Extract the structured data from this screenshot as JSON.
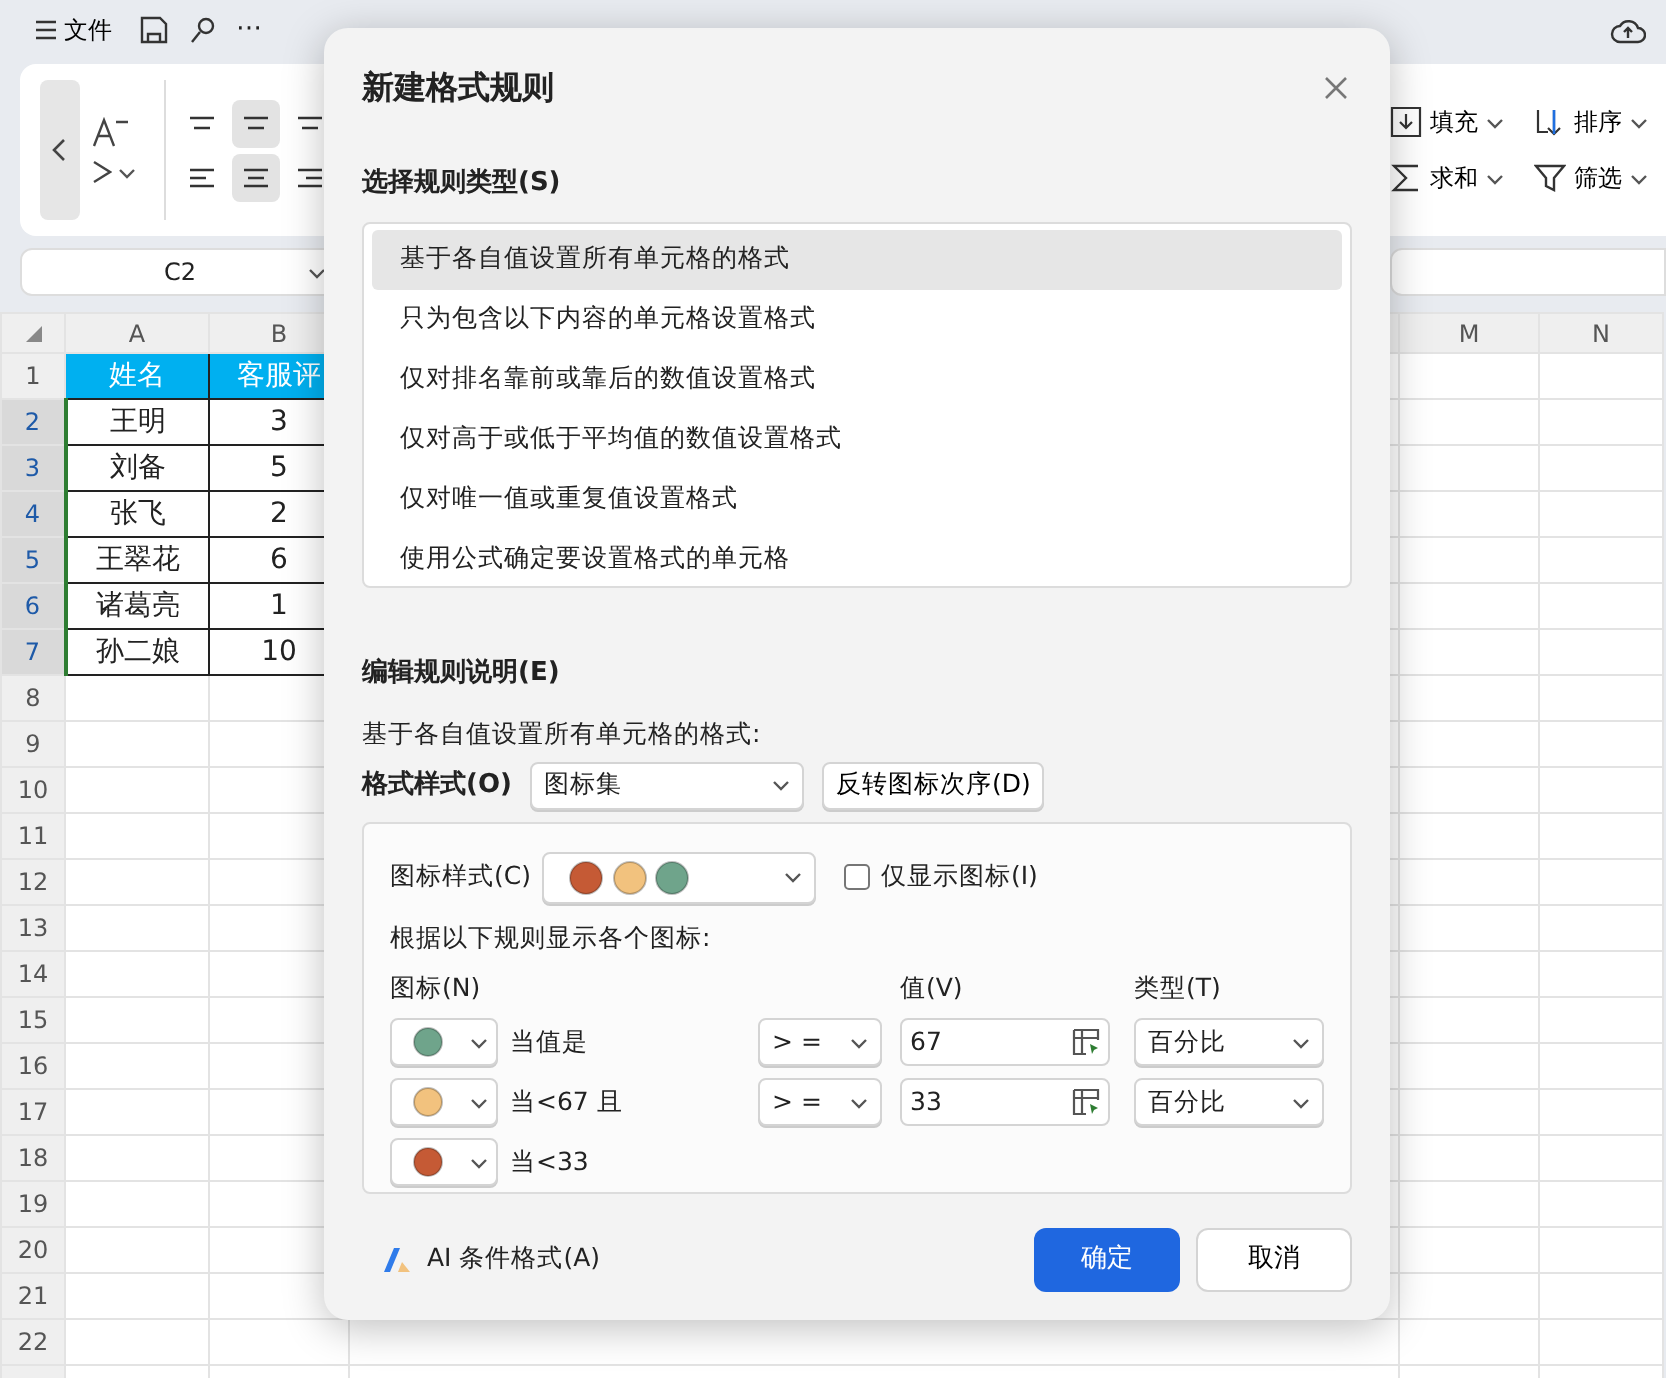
{
  "app_bar": {
    "menu": "文件",
    "more": "⋯"
  },
  "ribbon": {
    "align_buttons": [
      {
        "selected": false
      },
      {
        "selected": true
      },
      {
        "selected": false
      },
      {
        "selected": false
      },
      {
        "selected": true
      },
      {
        "selected": false
      }
    ],
    "commands": [
      {
        "label": "填充",
        "kind": "fill"
      },
      {
        "label": "排序",
        "kind": "sort"
      },
      {
        "label": "求和",
        "kind": "sum"
      },
      {
        "label": "筛选",
        "kind": "filter"
      }
    ]
  },
  "formula_bar": {
    "name_box": "C2"
  },
  "sheet": {
    "columns": [
      "A",
      "B",
      "M",
      "N"
    ],
    "rows": [
      {
        "number": "1",
        "selected": false,
        "kind": "header",
        "cells": [
          "姓名",
          "客服评"
        ]
      },
      {
        "number": "2",
        "selected": true,
        "kind": "data",
        "cells": [
          "王明",
          "3"
        ]
      },
      {
        "number": "3",
        "selected": true,
        "kind": "data",
        "cells": [
          "刘备",
          "5"
        ]
      },
      {
        "number": "4",
        "selected": true,
        "kind": "data",
        "cells": [
          "张飞",
          "2"
        ]
      },
      {
        "number": "5",
        "selected": true,
        "kind": "data",
        "cells": [
          "王翠花",
          "6"
        ]
      },
      {
        "number": "6",
        "selected": true,
        "kind": "data",
        "cells": [
          "诸葛亮",
          "1"
        ]
      },
      {
        "number": "7",
        "selected": true,
        "kind": "data",
        "cells": [
          "孙二娘",
          "10"
        ]
      },
      {
        "number": "8",
        "selected": false
      },
      {
        "number": "9",
        "selected": false
      },
      {
        "number": "10",
        "selected": false
      },
      {
        "number": "11",
        "selected": false
      },
      {
        "number": "12",
        "selected": false
      },
      {
        "number": "13",
        "selected": false
      },
      {
        "number": "14",
        "selected": false
      },
      {
        "number": "15",
        "selected": false
      },
      {
        "number": "16",
        "selected": false
      },
      {
        "number": "17",
        "selected": false
      },
      {
        "number": "18",
        "selected": false
      },
      {
        "number": "19",
        "selected": false
      },
      {
        "number": "20",
        "selected": false
      },
      {
        "number": "21",
        "selected": false
      },
      {
        "number": "22",
        "selected": false
      }
    ]
  },
  "dialog": {
    "title": "新建格式规则",
    "rule_type_label": "选择规则类型(S)",
    "rule_types": [
      {
        "label": "基于各自值设置所有单元格的格式",
        "selected": true
      },
      {
        "label": "只为包含以下内容的单元格设置格式",
        "selected": false
      },
      {
        "label": "仅对排名靠前或靠后的数值设置格式",
        "selected": false
      },
      {
        "label": "仅对高于或低于平均值的数值设置格式",
        "selected": false
      },
      {
        "label": "仅对唯一值或重复值设置格式",
        "selected": false
      },
      {
        "label": "使用公式确定要设置格式的单元格",
        "selected": false
      }
    ],
    "edit_label": "编辑规则说明(E)",
    "description": "基于各自值设置所有单元格的格式:",
    "format_style_label": "格式样式(O)",
    "format_style": "图标集",
    "reverse_button": "反转图标次序(D)",
    "icon_style_label": "图标样式(C)",
    "icon_style": [
      {
        "color": "#c55a35"
      },
      {
        "color": "#f2c27e"
      },
      {
        "color": "#6fa48b"
      }
    ],
    "icons_only": {
      "label": "仅显示图标(I)",
      "checked": false
    },
    "rules_caption": "根据以下规则显示各个图标:",
    "headers": {
      "icon": "图标(N)",
      "value": "值(V)",
      "type": "类型(T)"
    },
    "rules": [
      {
        "color": "#6fa48b",
        "text": "当值是",
        "operator": "> =",
        "value": "67",
        "type": "百分比"
      },
      {
        "color": "#f2c27e",
        "text": "当<67 且",
        "operator": "> =",
        "value": "33",
        "type": "百分比"
      },
      {
        "color": "#c55a35",
        "text": "当<33"
      }
    ],
    "ai_link": "AI 条件格式(A)",
    "ok": "确定",
    "cancel": "取消"
  }
}
